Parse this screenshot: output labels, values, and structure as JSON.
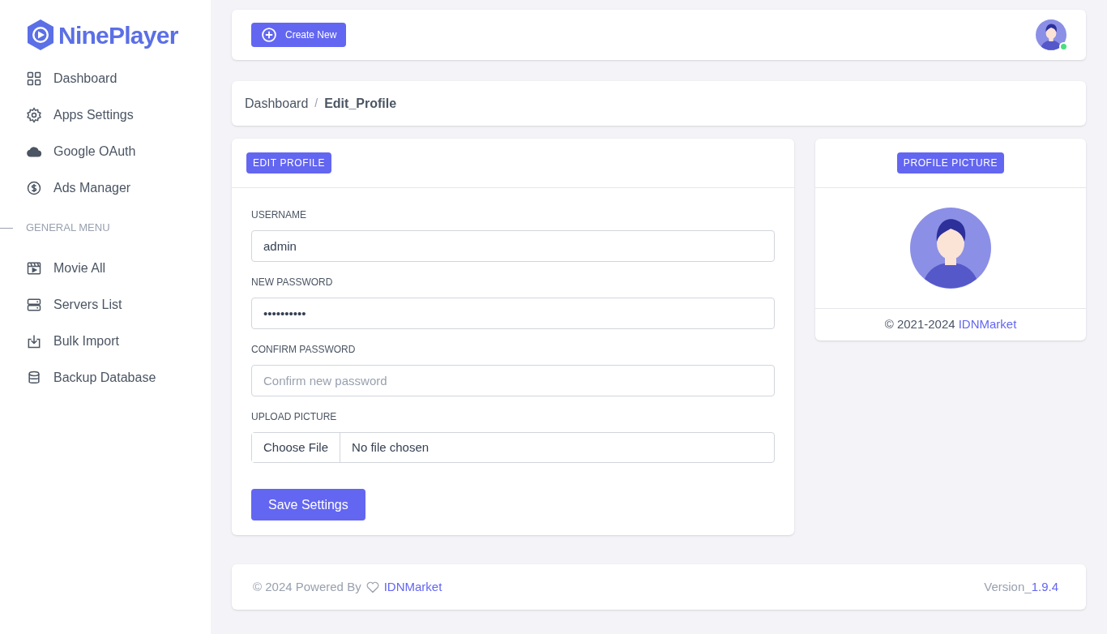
{
  "sidebar": {
    "logo": "NinePlayer",
    "items": [
      {
        "label": "Dashboard"
      },
      {
        "label": "Apps Settings"
      },
      {
        "label": "Google OAuth"
      },
      {
        "label": "Ads Manager"
      }
    ],
    "section_title": "GENERAL MENU",
    "general_items": [
      {
        "label": "Movie All"
      },
      {
        "label": "Servers List"
      },
      {
        "label": "Bulk Import"
      },
      {
        "label": "Backup Database"
      }
    ]
  },
  "header": {
    "create_button": "Create New",
    "user_online": true
  },
  "breadcrumb_separator": "/",
  "breadcrumb": [
    {
      "label": "Dashboard",
      "current": false
    },
    {
      "label": "Edit_Profile",
      "current": true
    }
  ],
  "edit_profile": {
    "badge": "EDIT PROFILE",
    "fields": [
      {
        "kind": "text",
        "label": "USERNAME",
        "value": "admin"
      },
      {
        "kind": "text",
        "label": "NEW PASSWORD",
        "value": "••••••••••"
      },
      {
        "kind": "text",
        "label": "CONFIRM PASSWORD",
        "placeholder": "Confirm new password"
      },
      {
        "kind": "file",
        "label": "UPLOAD PICTURE",
        "button": "Choose File",
        "status": "No file chosen"
      }
    ],
    "save_button": "Save Settings"
  },
  "profile_picture": {
    "badge": "PROFILE PICTURE",
    "copyright": "© 2021-2024",
    "link": "IDNMarket"
  },
  "footer": {
    "text": "© 2024 Powered By",
    "link": "IDNMarket",
    "version_label": "Version_",
    "version": "1.9.4"
  }
}
